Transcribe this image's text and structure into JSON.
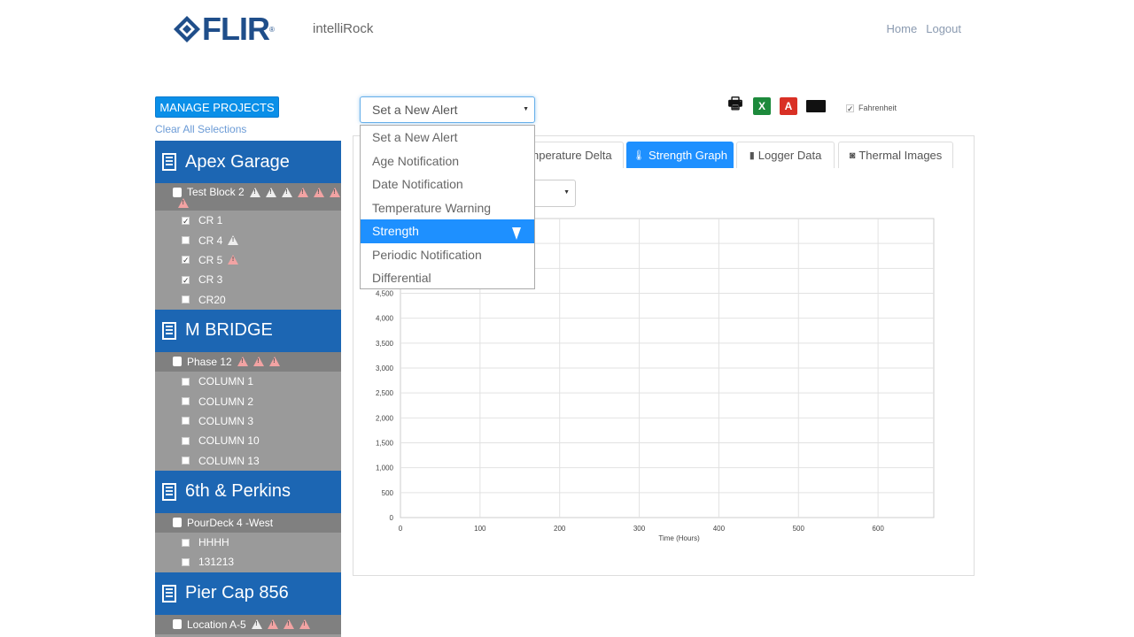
{
  "header": {
    "logo_text": "FLIR",
    "app_name": "intelliRock",
    "nav": [
      "Home",
      "Logout"
    ]
  },
  "sidebar": {
    "manage_label": "MANAGE PROJECTS",
    "clear_label": "Clear All Selections",
    "projects": [
      {
        "name": "Apex Garage",
        "locations": [
          {
            "name": "Test Block 2",
            "alerts": [
              "warn",
              "warn",
              "warn",
              "red",
              "red",
              "red",
              "red"
            ],
            "items": [
              {
                "label": "CR 1",
                "checked": true,
                "alerts": []
              },
              {
                "label": "CR 4",
                "checked": false,
                "alerts": [
                  "warn"
                ]
              },
              {
                "label": "CR 5",
                "checked": true,
                "alerts": [
                  "red"
                ]
              },
              {
                "label": "CR 3",
                "checked": true,
                "alerts": []
              },
              {
                "label": "CR20",
                "checked": false,
                "alerts": []
              }
            ]
          }
        ]
      },
      {
        "name": "M BRIDGE",
        "locations": [
          {
            "name": "Phase 12",
            "alerts": [
              "red",
              "red",
              "red"
            ],
            "items": [
              {
                "label": "COLUMN 1",
                "checked": false,
                "alerts": []
              },
              {
                "label": "COLUMN 2",
                "checked": false,
                "alerts": []
              },
              {
                "label": "COLUMN 3",
                "checked": false,
                "alerts": []
              },
              {
                "label": "COLUMN 10",
                "checked": false,
                "alerts": []
              },
              {
                "label": "COLUMN 13",
                "checked": false,
                "alerts": []
              }
            ]
          }
        ]
      },
      {
        "name": "6th & Perkins",
        "locations": [
          {
            "name": "PourDeck 4 -West",
            "alerts": [],
            "items": [
              {
                "label": "HHHH",
                "checked": false,
                "alerts": []
              },
              {
                "label": "131213",
                "checked": false,
                "alerts": []
              }
            ]
          }
        ]
      },
      {
        "name": "Pier Cap 856",
        "locations": [
          {
            "name": "Location A-5",
            "alerts": [
              "warn",
              "red",
              "red",
              "red"
            ],
            "items": []
          }
        ]
      }
    ]
  },
  "alert_select": {
    "value": "Set a New Alert",
    "options": [
      "Set a New Alert",
      "Age Notification",
      "Date Notification",
      "Temperature Warning",
      "Strength",
      "Periodic Notification",
      "Differential"
    ],
    "highlighted": "Strength"
  },
  "toolbar": {
    "icons": [
      "print-icon",
      "excel-icon",
      "pdf-icon",
      "email-icon"
    ],
    "fahrenheit_label": "Fahrenheit",
    "fahrenheit_checked": true
  },
  "tabs": [
    {
      "label": "mperature Delta",
      "icon": "",
      "active": false
    },
    {
      "label": "Strength Graph",
      "icon": "thermometer-icon",
      "active": true
    },
    {
      "label": "Logger Data",
      "icon": "bar-chart-icon",
      "active": false
    },
    {
      "label": "Thermal Images",
      "icon": "camera-icon",
      "active": false
    }
  ],
  "chart_data": {
    "type": "line",
    "title": "",
    "xlabel": "Time (Hours)",
    "ylabel": "",
    "x_ticks": [
      0,
      100,
      200,
      300,
      400,
      500,
      600
    ],
    "y_ticks": [
      0,
      500,
      1000,
      1500,
      2000,
      2500,
      3000,
      3500,
      4000,
      4500
    ],
    "y_tick_labels": [
      "0",
      "500",
      "1,000",
      "1,500",
      "2,000",
      "2,500",
      "3,000",
      "3,500",
      "4,000",
      "4,500"
    ],
    "xlim": [
      0,
      670
    ],
    "ylim": [
      0,
      6000
    ],
    "grid": true,
    "series": []
  },
  "colors": {
    "brand_blue": "#1c66b3",
    "accent": "#1e90ff"
  }
}
